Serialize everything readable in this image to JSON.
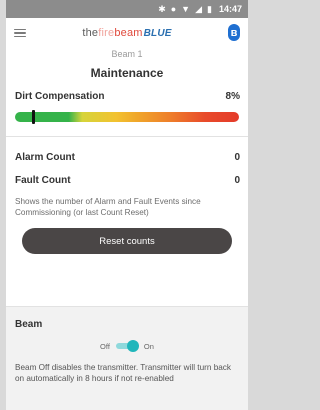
{
  "status_bar": {
    "icons": [
      "bluetooth-icon",
      "do-not-disturb-icon",
      "wifi-icon",
      "signal-icon",
      "battery-icon"
    ],
    "time": "14:47"
  },
  "app_bar": {
    "logo": {
      "part1": "the",
      "part2": "fire",
      "part3": "beam",
      "part4": "BLUE"
    },
    "menu_icon": "hamburger-menu-icon",
    "bluetooth_icon": "bluetooth-icon"
  },
  "beam_name": "Beam 1",
  "title": "Maintenance",
  "dirt_compensation": {
    "label": "Dirt Compensation",
    "value": "8%",
    "level": 0.08
  },
  "counts": {
    "alarm_label": "Alarm Count",
    "alarm_value": "0",
    "fault_label": "Fault Count",
    "fault_value": "0",
    "description": "Shows the number of Alarm and Fault Events since Commissioning (or last Count Reset)",
    "reset_button": "Reset counts"
  },
  "beam": {
    "label": "Beam",
    "off_label": "Off",
    "on_label": "On",
    "toggle_on": true,
    "description": "Beam Off disables the transmitter. Transmitter will turn back on automatically in 8 hours if not re-enabled"
  },
  "colors": {
    "accent_toggle": "#20b6bb",
    "button": "#4a4646",
    "bluetooth": "#1f6fd1"
  }
}
